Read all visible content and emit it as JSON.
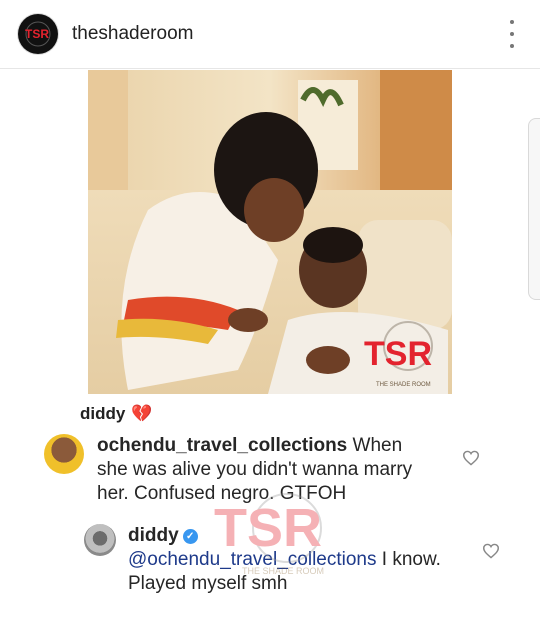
{
  "header": {
    "username": "theshaderoom",
    "avatar_text": "TSR"
  },
  "photo": {
    "watermark_text": "TSR",
    "watermark_sub": "THE SHADE ROOM"
  },
  "caption": {
    "username": "diddy",
    "text": "💔"
  },
  "comments": [
    {
      "handle": "ochendu_travel_collections",
      "text": " When she was alive you didn't wanna marry her. Confused negro. GTFOH"
    },
    {
      "handle": "diddy",
      "verified": true,
      "mention": "@ochendu_travel_collections",
      "text": " I know. Played myself smh"
    }
  ],
  "colors": {
    "accent_red": "#e3232e",
    "verified_blue": "#3897f0",
    "mention_blue": "#1e3a8a"
  }
}
